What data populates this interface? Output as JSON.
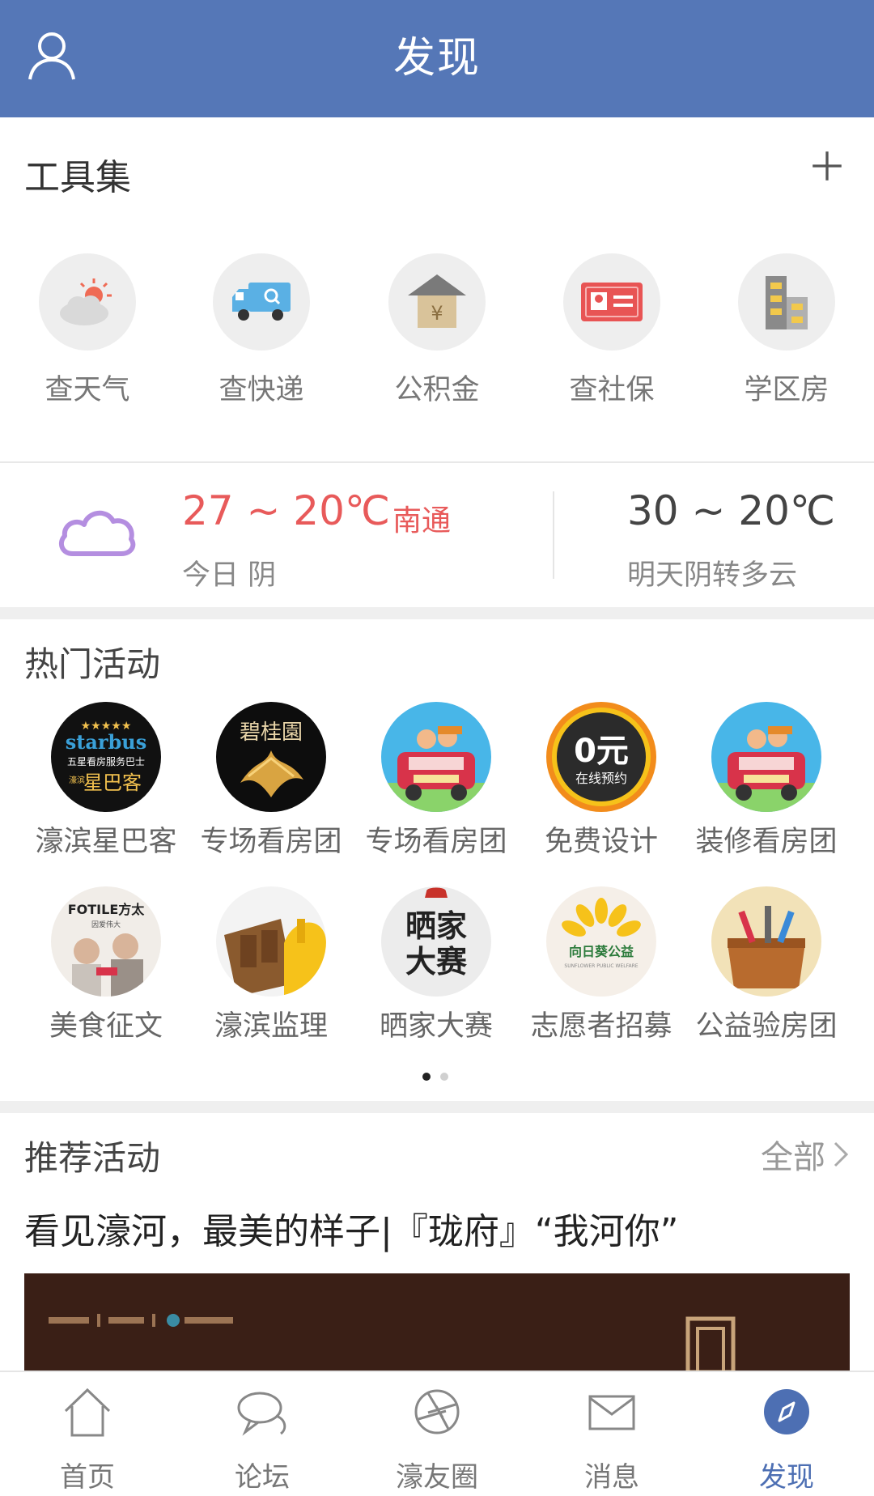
{
  "header": {
    "title": "发现"
  },
  "tools": {
    "title": "工具集",
    "items": [
      {
        "label": "查天气",
        "icon": "weather-icon"
      },
      {
        "label": "查快递",
        "icon": "delivery-truck-icon"
      },
      {
        "label": "公积金",
        "icon": "housing-fund-icon"
      },
      {
        "label": "查社保",
        "icon": "id-card-icon"
      },
      {
        "label": "学区房",
        "icon": "building-icon"
      }
    ]
  },
  "weather": {
    "today_temp": "27 ~ 20℃",
    "city": "南通",
    "today_desc": "今日 阴",
    "tomorrow_temp": "30 ~ 20℃",
    "tomorrow_desc": "明天阴转多云"
  },
  "hot": {
    "title": "热门活动",
    "items": [
      {
        "label": "濠滨星巴客",
        "badge_text_1": "starbus",
        "badge_text_2": "五星看房服务巴士",
        "badge_text_3": "濠滨",
        "badge_text_4": "星巴客"
      },
      {
        "label": "专场看房团",
        "badge_text_1": "碧桂園"
      },
      {
        "label": "专场看房团"
      },
      {
        "label": "免费设计",
        "badge_text_1": "0元",
        "badge_text_2": "在线预约"
      },
      {
        "label": "装修看房团"
      },
      {
        "label": "美食征文",
        "badge_text_1": "FOTILE方太",
        "badge_text_2": "因爱伟大"
      },
      {
        "label": "濠滨监理"
      },
      {
        "label": "晒家大赛",
        "badge_text_1": "晒家",
        "badge_text_2": "大赛"
      },
      {
        "label": "志愿者招募",
        "badge_text_1": "向日葵公益",
        "badge_text_2": "SUNFLOWER PUBLIC WELFARE"
      },
      {
        "label": "公益验房团"
      }
    ],
    "page_count": 2,
    "current_page": 1
  },
  "recommend": {
    "title": "推荐活动",
    "all_label": "全部",
    "article_title": "看见濠河，最美的样子|『珑府』“我河你”"
  },
  "tabbar": {
    "items": [
      {
        "label": "首页",
        "icon": "home-icon",
        "active": false
      },
      {
        "label": "论坛",
        "icon": "chat-bubble-icon",
        "active": false
      },
      {
        "label": "濠友圈",
        "icon": "aperture-icon",
        "active": false
      },
      {
        "label": "消息",
        "icon": "mail-icon",
        "active": false
      },
      {
        "label": "发现",
        "icon": "compass-icon",
        "active": true
      }
    ]
  },
  "colors": {
    "brand": "#5577b7",
    "accent_red": "#e85a5a",
    "active_tab": "#4d6fb3"
  }
}
